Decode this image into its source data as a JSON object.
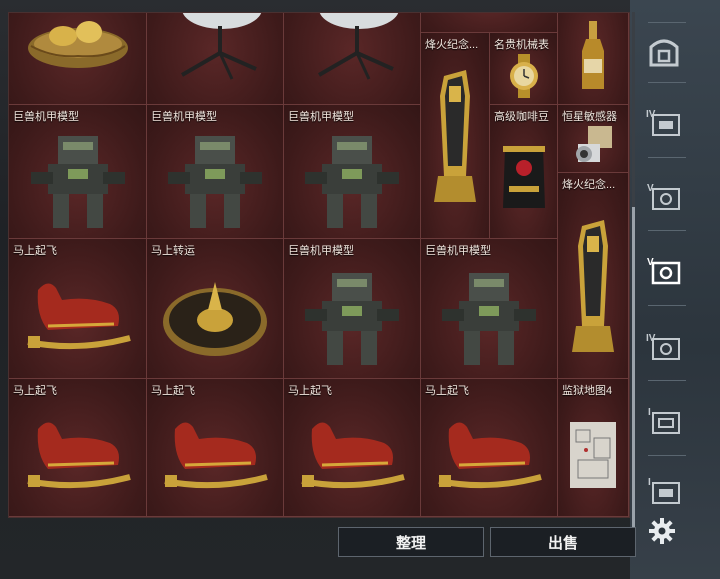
{
  "inventory": {
    "items": [
      {
        "label": "",
        "art": "nest"
      },
      {
        "label": "",
        "art": "dish"
      },
      {
        "label": "",
        "art": "dish"
      },
      {
        "label": "",
        "art": "blank"
      },
      {
        "label": "",
        "art": "bottle"
      },
      {
        "label": "烽火纪念...",
        "art": "trophy"
      },
      {
        "label": "名贵机械表",
        "art": "watch"
      },
      {
        "label": "巨兽机甲模型",
        "art": "mech"
      },
      {
        "label": "巨兽机甲模型",
        "art": "mech"
      },
      {
        "label": "巨兽机甲模型",
        "art": "mech"
      },
      {
        "label": "高级咖啡豆",
        "art": "coffee"
      },
      {
        "label": "恒星敏感器",
        "art": "sensor"
      },
      {
        "label": "烽火纪念...",
        "art": "trophy"
      },
      {
        "label": "马上起飞",
        "art": "horse"
      },
      {
        "label": "马上转运",
        "art": "wheel"
      },
      {
        "label": "巨兽机甲模型",
        "art": "mech"
      },
      {
        "label": "巨兽机甲模型",
        "art": "mech"
      },
      {
        "label": "马上起飞",
        "art": "horse"
      },
      {
        "label": "马上起飞",
        "art": "horse"
      },
      {
        "label": "马上起飞",
        "art": "horse"
      },
      {
        "label": "马上起飞",
        "art": "horse"
      },
      {
        "label": "监狱地图4",
        "art": "map"
      }
    ]
  },
  "sidebar": {
    "tabs": [
      {
        "icon": "safe-box-icon"
      },
      {
        "icon": "case-iv-icon",
        "level": "IV"
      },
      {
        "icon": "case-v-icon",
        "level": "V"
      },
      {
        "icon": "case-v-selected-icon",
        "level": "V"
      },
      {
        "icon": "case-iv-icon",
        "level": "IV"
      },
      {
        "icon": "case-i-icon",
        "level": "I"
      },
      {
        "icon": "case-i-icon",
        "level": "I"
      }
    ]
  },
  "actions": {
    "organize_label": "整理",
    "sell_label": "出售"
  },
  "colors": {
    "cell_bg": "#3d1a1a",
    "gold": "#c9a23a",
    "horse_red": "#a52a1e"
  }
}
